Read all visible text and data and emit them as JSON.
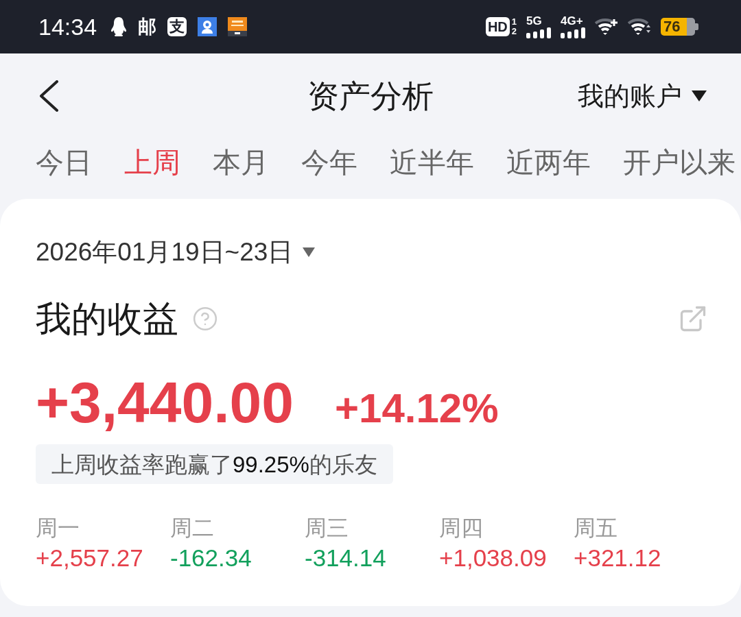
{
  "status_bar": {
    "time": "14:34",
    "notifications": [
      {
        "kind": "penguin"
      },
      {
        "kind": "glyph",
        "text": "邮"
      },
      {
        "kind": "tile",
        "text": "支"
      },
      {
        "kind": "camera"
      },
      {
        "kind": "orange-app"
      }
    ],
    "hd": {
      "label": "HD",
      "sims": [
        "1",
        "2"
      ]
    },
    "signals": [
      {
        "label": "5G"
      },
      {
        "label": "4G+"
      }
    ],
    "battery": "76"
  },
  "header": {
    "title": "资产分析",
    "account": "我的账户"
  },
  "tabs": [
    {
      "label": "今日",
      "selected": false
    },
    {
      "label": "上周",
      "selected": true
    },
    {
      "label": "本月",
      "selected": false
    },
    {
      "label": "今年",
      "selected": false
    },
    {
      "label": "近半年",
      "selected": false
    },
    {
      "label": "近两年",
      "selected": false
    },
    {
      "label": "开户以来",
      "selected": false
    }
  ],
  "card": {
    "date_range": "2026年01月19日~23日",
    "title": "我的收益",
    "amount": "+3,440.00",
    "rate": "+14.12%",
    "ranking": "上周收益率跑赢了**99.25%**的乐友",
    "days": [
      {
        "label": "周一",
        "value": "+2,557.27",
        "color": "#e5404b"
      },
      {
        "label": "周二",
        "value": "-162.34",
        "color": "#12a05c"
      },
      {
        "label": "周三",
        "value": "-314.14",
        "color": "#12a05c"
      },
      {
        "label": "周四",
        "value": "+1,038.09",
        "color": "#e5404b"
      },
      {
        "label": "周五",
        "value": "+321.12",
        "color": "#e5404b"
      }
    ]
  }
}
